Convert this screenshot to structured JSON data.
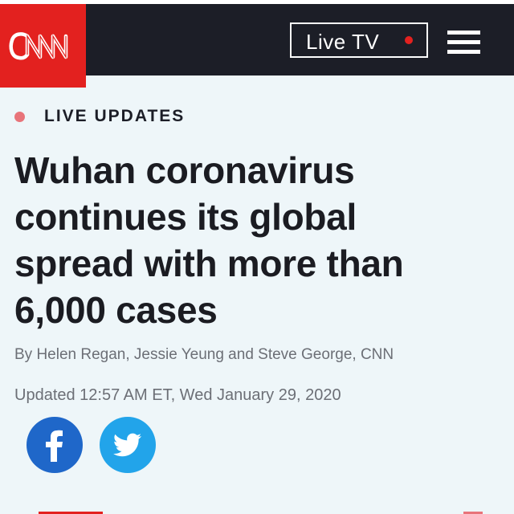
{
  "header": {
    "logo_text": "CNN",
    "live_tv_label": "Live TV",
    "brand_color": "#e3211f",
    "menu_icon": "hamburger-menu-icon"
  },
  "article": {
    "section_label": "LIVE UPDATES",
    "headline_lines": [
      "Wuhan coronavirus",
      "continues its global",
      "spread with more than",
      "6,000 cases"
    ],
    "byline": "By Helen Regan, Jessie Yeung and Steve George, CNN",
    "updated": "Updated 12:57 AM ET, Wed January 29, 2020"
  },
  "share": {
    "facebook_icon": "facebook-icon",
    "twitter_icon": "twitter-icon",
    "facebook_color": "#1f67c9",
    "twitter_color": "#22a4ea"
  }
}
